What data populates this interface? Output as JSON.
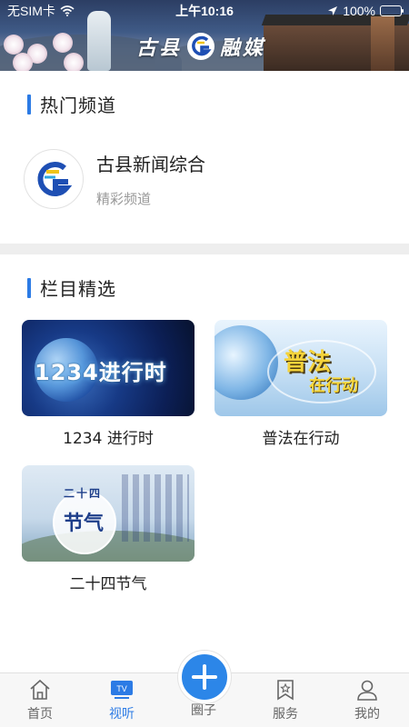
{
  "status_bar": {
    "carrier": "无SIM卡",
    "time": "上午10:16",
    "battery": "100%",
    "battery_level": 1.0
  },
  "banner": {
    "title_left": "古县",
    "title_right": "融媒"
  },
  "hot_section": {
    "title": "热门频道",
    "channel": {
      "name": "古县新闻综合",
      "subtitle": "精彩频道"
    }
  },
  "column_section": {
    "title": "栏目精选",
    "cards": [
      {
        "label": "1234 进行时",
        "thumb_text": "1234进行时"
      },
      {
        "label": "普法在行动",
        "thumb_text_a": "普法",
        "thumb_text_b": "在行动"
      },
      {
        "label": "二十四节气",
        "thumb_text_small": "二十四",
        "thumb_text_big": "节气"
      }
    ]
  },
  "tabbar": {
    "items": [
      {
        "label": "首页",
        "icon": "home-icon"
      },
      {
        "label": "视听",
        "icon": "tv-icon",
        "badge": "TV"
      },
      {
        "label": "圈子",
        "icon": "plus-icon"
      },
      {
        "label": "服务",
        "icon": "bookmark-star-icon"
      },
      {
        "label": "我的",
        "icon": "user-icon"
      }
    ],
    "active_index": 1,
    "accent_color": "#2c7be5"
  }
}
